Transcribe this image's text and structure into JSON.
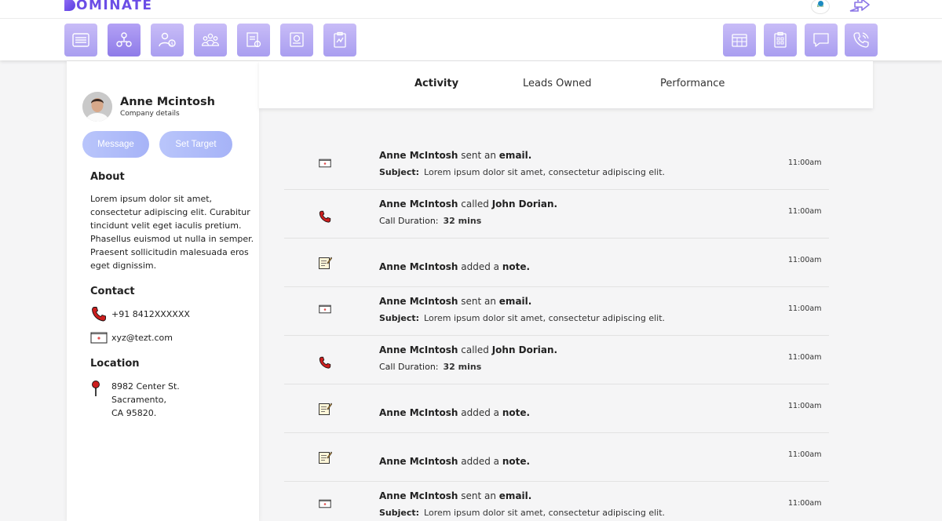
{
  "brand": {
    "logo_rest": "OMINATE",
    "company_logo_text": "blue"
  },
  "nav": {
    "left": [
      "dashboard",
      "leads",
      "finance",
      "team",
      "reports",
      "documents",
      "tasks"
    ],
    "right": [
      "calendar",
      "clipboard",
      "chat",
      "calls"
    ]
  },
  "profile": {
    "name": "Anne Mcintosh",
    "subtitle": "Company details",
    "message_label": "Message",
    "target_label": "Set Target",
    "about_title": "About",
    "about_text": "Lorem ipsum dolor sit amet, consectetur adipiscing elit. Curabitur tincidunt velit eget iaculis pretium. Phasellus euismod ut nulla in semper. Praesent sollicitudin malesuada eros eget dignissim.",
    "contact_title": "Contact",
    "phone": "+91 8412XXXXXX",
    "email": "xyz@tezt.com",
    "location_title": "Location",
    "address_line1": "8982 Center St.",
    "address_line2": "Sacramento,",
    "address_line3": "CA 95820."
  },
  "tabs": [
    "Activity",
    "Leads Owned",
    "Performance"
  ],
  "activities": [
    {
      "type": "email",
      "actor": "Anne McIntosh",
      "verb": "sent an",
      "object": "email.",
      "sub_label": "Subject:",
      "sub_value": "Lorem ipsum dolor sit amet, consectetur adipiscing elit.",
      "time": "11:00am"
    },
    {
      "type": "call",
      "actor": "Anne McIntosh",
      "verb": "called",
      "object": "John Dorian.",
      "sub_label": "Call Duration:",
      "sub_value": "32 mins",
      "time": "11:00am"
    },
    {
      "type": "note",
      "actor": "Anne McIntosh",
      "verb": "added a",
      "object": "note.",
      "time": "11:00am"
    },
    {
      "type": "email",
      "actor": "Anne McIntosh",
      "verb": "sent an",
      "object": "email.",
      "sub_label": "Subject:",
      "sub_value": "Lorem ipsum dolor sit amet, consectetur adipiscing elit.",
      "time": "11:00am"
    },
    {
      "type": "call",
      "actor": "Anne McIntosh",
      "verb": "called",
      "object": "John Dorian.",
      "sub_label": "Call Duration:",
      "sub_value": "32 mins",
      "time": "11:00am"
    },
    {
      "type": "note",
      "actor": "Anne McIntosh",
      "verb": "added a",
      "object": "note.",
      "time": "11:00am"
    },
    {
      "type": "note",
      "actor": "Anne McIntosh",
      "verb": "added a",
      "object": "note.",
      "time": "11:00am"
    },
    {
      "type": "email",
      "actor": "Anne McIntosh",
      "verb": "sent an",
      "object": "email.",
      "sub_label": "Subject:",
      "sub_value": "Lorem ipsum dolor sit amet, consectetur adipiscing elit.",
      "time": "11:00am"
    }
  ],
  "colors": {
    "brand_purple": "#6b4de6",
    "nav_button": "#b3a6f2",
    "pill_button": "#b0bcf9",
    "phone_red": "#cc1f1f"
  }
}
